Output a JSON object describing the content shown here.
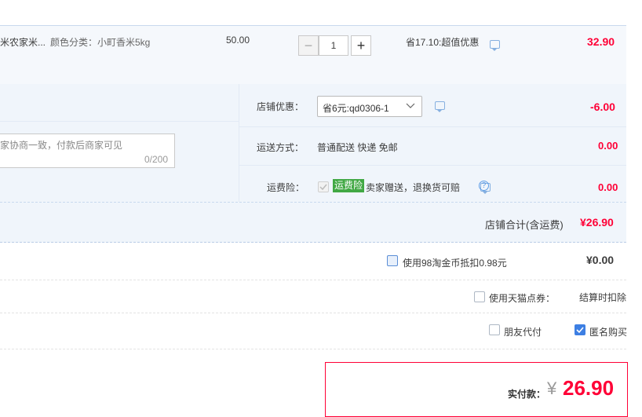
{
  "item": {
    "title": "米农家米...",
    "sku": "颜色分类：小町香米5kg",
    "unit_price": "50.00",
    "quantity": "1",
    "minus_label": "−",
    "plus_label": "+",
    "promo": "省17.10:超值优惠",
    "subtotal": "32.90"
  },
  "message_box": {
    "placeholder": "家协商一致，付款后商家可见",
    "counter": "0/200"
  },
  "shop_options": {
    "coupon_label": "店铺优惠：",
    "coupon_value": "省6元:qd0306-1",
    "coupon_amount": "-6.00",
    "shipping_label": "运送方式：",
    "shipping_value": "普通配送 快递 免邮",
    "shipping_amount": "0.00",
    "insurance_label": "运费险：",
    "insurance_badge": "运费险",
    "insurance_desc": "卖家赠送，退换货可赔",
    "insurance_amount": "0.00"
  },
  "shop_total": {
    "label": "店铺合计(含运费)",
    "value": "¥26.90"
  },
  "payment_options": {
    "taobao_coin_label": "使用98淘金币抵扣0.98元",
    "taobao_coin_amount": "¥0.00",
    "tmall_points_label": "使用天猫点券：",
    "tmall_points_value": "结算时扣除",
    "friend_pay_label": "朋友代付",
    "anonymous_label": "匿名购买"
  },
  "total": {
    "label": "实付款：",
    "currency": "¥",
    "value": "26.90"
  },
  "colors": {
    "accent_red": "#ff0036",
    "blue_border": "#c8d9ee",
    "insurance_green": "#41a844",
    "checkbox_blue": "#3d7fe3"
  }
}
